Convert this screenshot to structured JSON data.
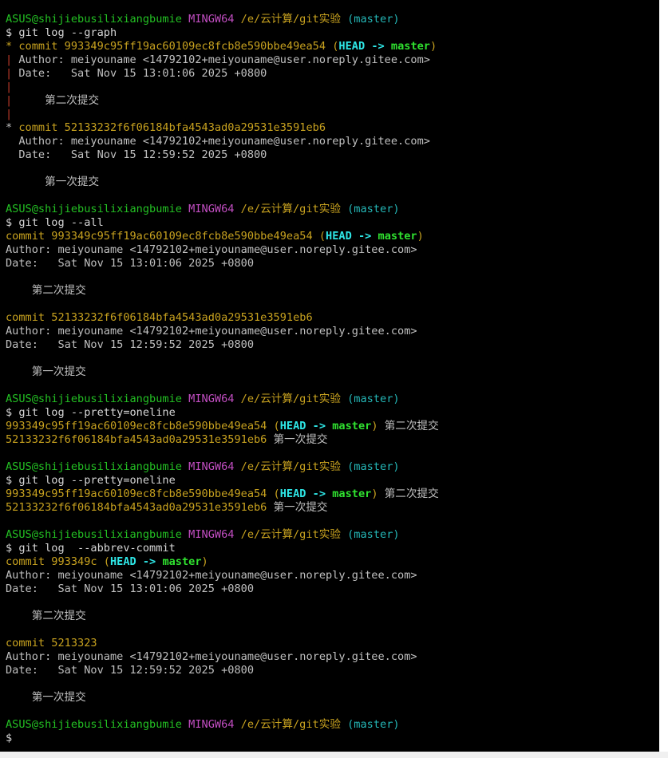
{
  "palette": {
    "background": "#000000",
    "prompt_user": "#23c023",
    "prompt_env": "#c24ec2",
    "prompt_path": "#c8a21f",
    "branch": "#25b9b9",
    "head_ref": "#2ee6e6",
    "master_ref": "#2fe02f",
    "graph_line": "#c0392b",
    "text": "#c0c0c0"
  },
  "lines": [
    [
      [
        "ASUS@shijiebusilixiangbumie",
        "green"
      ],
      [
        " ",
        "grey"
      ],
      [
        "MINGW64",
        "magenta"
      ],
      [
        " ",
        "grey"
      ],
      [
        "/e/云计算/git实验",
        "yellow"
      ],
      [
        " ",
        "grey"
      ],
      [
        "(master)",
        "cyan"
      ]
    ],
    [
      [
        "$ git log --graph",
        "white"
      ]
    ],
    [
      [
        "*",
        "yellow"
      ],
      [
        " commit 993349c95ff19ac60109ec8fcb8e590bbe49ea54 (",
        "yellow"
      ],
      [
        "HEAD -> ",
        "bcyan"
      ],
      [
        "master",
        "bgreen"
      ],
      [
        ")",
        "yellow"
      ]
    ],
    [
      [
        "|",
        "red"
      ],
      [
        " Author: meiyouname <14792102+meiyouname@user.noreply.gitee.com>",
        "grey"
      ]
    ],
    [
      [
        "|",
        "red"
      ],
      [
        " Date:   Sat Nov 15 13:01:06 2025 +0800",
        "grey"
      ]
    ],
    [
      [
        "|",
        "red"
      ]
    ],
    [
      [
        "|",
        "red"
      ],
      [
        "     第二次提交",
        "grey"
      ]
    ],
    [
      [
        "|",
        "red"
      ]
    ],
    [
      [
        "*",
        "grey"
      ],
      [
        " commit 52133232f6f06184bfa4543ad0a29531e3591eb6",
        "yellow"
      ]
    ],
    [
      [
        "  Author: meiyouname <14792102+meiyouname@user.noreply.gitee.com>",
        "grey"
      ]
    ],
    [
      [
        "  Date:   Sat Nov 15 12:59:52 2025 +0800",
        "grey"
      ]
    ],
    [
      [
        "",
        "grey"
      ]
    ],
    [
      [
        "      第一次提交",
        "grey"
      ]
    ],
    [
      [
        "",
        "grey"
      ]
    ],
    [
      [
        "ASUS@shijiebusilixiangbumie",
        "green"
      ],
      [
        " ",
        "grey"
      ],
      [
        "MINGW64",
        "magenta"
      ],
      [
        " ",
        "grey"
      ],
      [
        "/e/云计算/git实验",
        "yellow"
      ],
      [
        " ",
        "grey"
      ],
      [
        "(master)",
        "cyan"
      ]
    ],
    [
      [
        "$ git log --all",
        "white"
      ]
    ],
    [
      [
        "commit 993349c95ff19ac60109ec8fcb8e590bbe49ea54 (",
        "yellow"
      ],
      [
        "HEAD -> ",
        "bcyan"
      ],
      [
        "master",
        "bgreen"
      ],
      [
        ")",
        "yellow"
      ]
    ],
    [
      [
        "Author: meiyouname <14792102+meiyouname@user.noreply.gitee.com>",
        "grey"
      ]
    ],
    [
      [
        "Date:   Sat Nov 15 13:01:06 2025 +0800",
        "grey"
      ]
    ],
    [
      [
        "",
        "grey"
      ]
    ],
    [
      [
        "    第二次提交",
        "grey"
      ]
    ],
    [
      [
        "",
        "grey"
      ]
    ],
    [
      [
        "commit 52133232f6f06184bfa4543ad0a29531e3591eb6",
        "yellow"
      ]
    ],
    [
      [
        "Author: meiyouname <14792102+meiyouname@user.noreply.gitee.com>",
        "grey"
      ]
    ],
    [
      [
        "Date:   Sat Nov 15 12:59:52 2025 +0800",
        "grey"
      ]
    ],
    [
      [
        "",
        "grey"
      ]
    ],
    [
      [
        "    第一次提交",
        "grey"
      ]
    ],
    [
      [
        "",
        "grey"
      ]
    ],
    [
      [
        "ASUS@shijiebusilixiangbumie",
        "green"
      ],
      [
        " ",
        "grey"
      ],
      [
        "MINGW64",
        "magenta"
      ],
      [
        " ",
        "grey"
      ],
      [
        "/e/云计算/git实验",
        "yellow"
      ],
      [
        " ",
        "grey"
      ],
      [
        "(master)",
        "cyan"
      ]
    ],
    [
      [
        "$ git log --pretty=oneline",
        "white"
      ]
    ],
    [
      [
        "993349c95ff19ac60109ec8fcb8e590bbe49ea54 (",
        "yellow"
      ],
      [
        "HEAD -> ",
        "bcyan"
      ],
      [
        "master",
        "bgreen"
      ],
      [
        ")",
        "yellow"
      ],
      [
        " 第二次提交",
        "grey"
      ]
    ],
    [
      [
        "52133232f6f06184bfa4543ad0a29531e3591eb6",
        "yellow"
      ],
      [
        " 第一次提交",
        "grey"
      ]
    ],
    [
      [
        "",
        "grey"
      ]
    ],
    [
      [
        "ASUS@shijiebusilixiangbumie",
        "green"
      ],
      [
        " ",
        "grey"
      ],
      [
        "MINGW64",
        "magenta"
      ],
      [
        " ",
        "grey"
      ],
      [
        "/e/云计算/git实验",
        "yellow"
      ],
      [
        " ",
        "grey"
      ],
      [
        "(master)",
        "cyan"
      ]
    ],
    [
      [
        "$ git log --pretty=oneline",
        "white"
      ]
    ],
    [
      [
        "993349c95ff19ac60109ec8fcb8e590bbe49ea54 (",
        "yellow"
      ],
      [
        "HEAD -> ",
        "bcyan"
      ],
      [
        "master",
        "bgreen"
      ],
      [
        ")",
        "yellow"
      ],
      [
        " 第二次提交",
        "grey"
      ]
    ],
    [
      [
        "52133232f6f06184bfa4543ad0a29531e3591eb6",
        "yellow"
      ],
      [
        " 第一次提交",
        "grey"
      ]
    ],
    [
      [
        "",
        "grey"
      ]
    ],
    [
      [
        "ASUS@shijiebusilixiangbumie",
        "green"
      ],
      [
        " ",
        "grey"
      ],
      [
        "MINGW64",
        "magenta"
      ],
      [
        " ",
        "grey"
      ],
      [
        "/e/云计算/git实验",
        "yellow"
      ],
      [
        " ",
        "grey"
      ],
      [
        "(master)",
        "cyan"
      ]
    ],
    [
      [
        "$ git log  --abbrev-commit",
        "white"
      ]
    ],
    [
      [
        "commit 993349c (",
        "yellow"
      ],
      [
        "HEAD -> ",
        "bcyan"
      ],
      [
        "master",
        "bgreen"
      ],
      [
        ")",
        "yellow"
      ]
    ],
    [
      [
        "Author: meiyouname <14792102+meiyouname@user.noreply.gitee.com>",
        "grey"
      ]
    ],
    [
      [
        "Date:   Sat Nov 15 13:01:06 2025 +0800",
        "grey"
      ]
    ],
    [
      [
        "",
        "grey"
      ]
    ],
    [
      [
        "    第二次提交",
        "grey"
      ]
    ],
    [
      [
        "",
        "grey"
      ]
    ],
    [
      [
        "commit 5213323",
        "yellow"
      ]
    ],
    [
      [
        "Author: meiyouname <14792102+meiyouname@user.noreply.gitee.com>",
        "grey"
      ]
    ],
    [
      [
        "Date:   Sat Nov 15 12:59:52 2025 +0800",
        "grey"
      ]
    ],
    [
      [
        "",
        "grey"
      ]
    ],
    [
      [
        "    第一次提交",
        "grey"
      ]
    ],
    [
      [
        "",
        "grey"
      ]
    ],
    [
      [
        "ASUS@shijiebusilixiangbumie",
        "green"
      ],
      [
        " ",
        "grey"
      ],
      [
        "MINGW64",
        "magenta"
      ],
      [
        " ",
        "grey"
      ],
      [
        "/e/云计算/git实验",
        "yellow"
      ],
      [
        " ",
        "grey"
      ],
      [
        "(master)",
        "cyan"
      ]
    ],
    [
      [
        "$",
        "white"
      ]
    ]
  ]
}
